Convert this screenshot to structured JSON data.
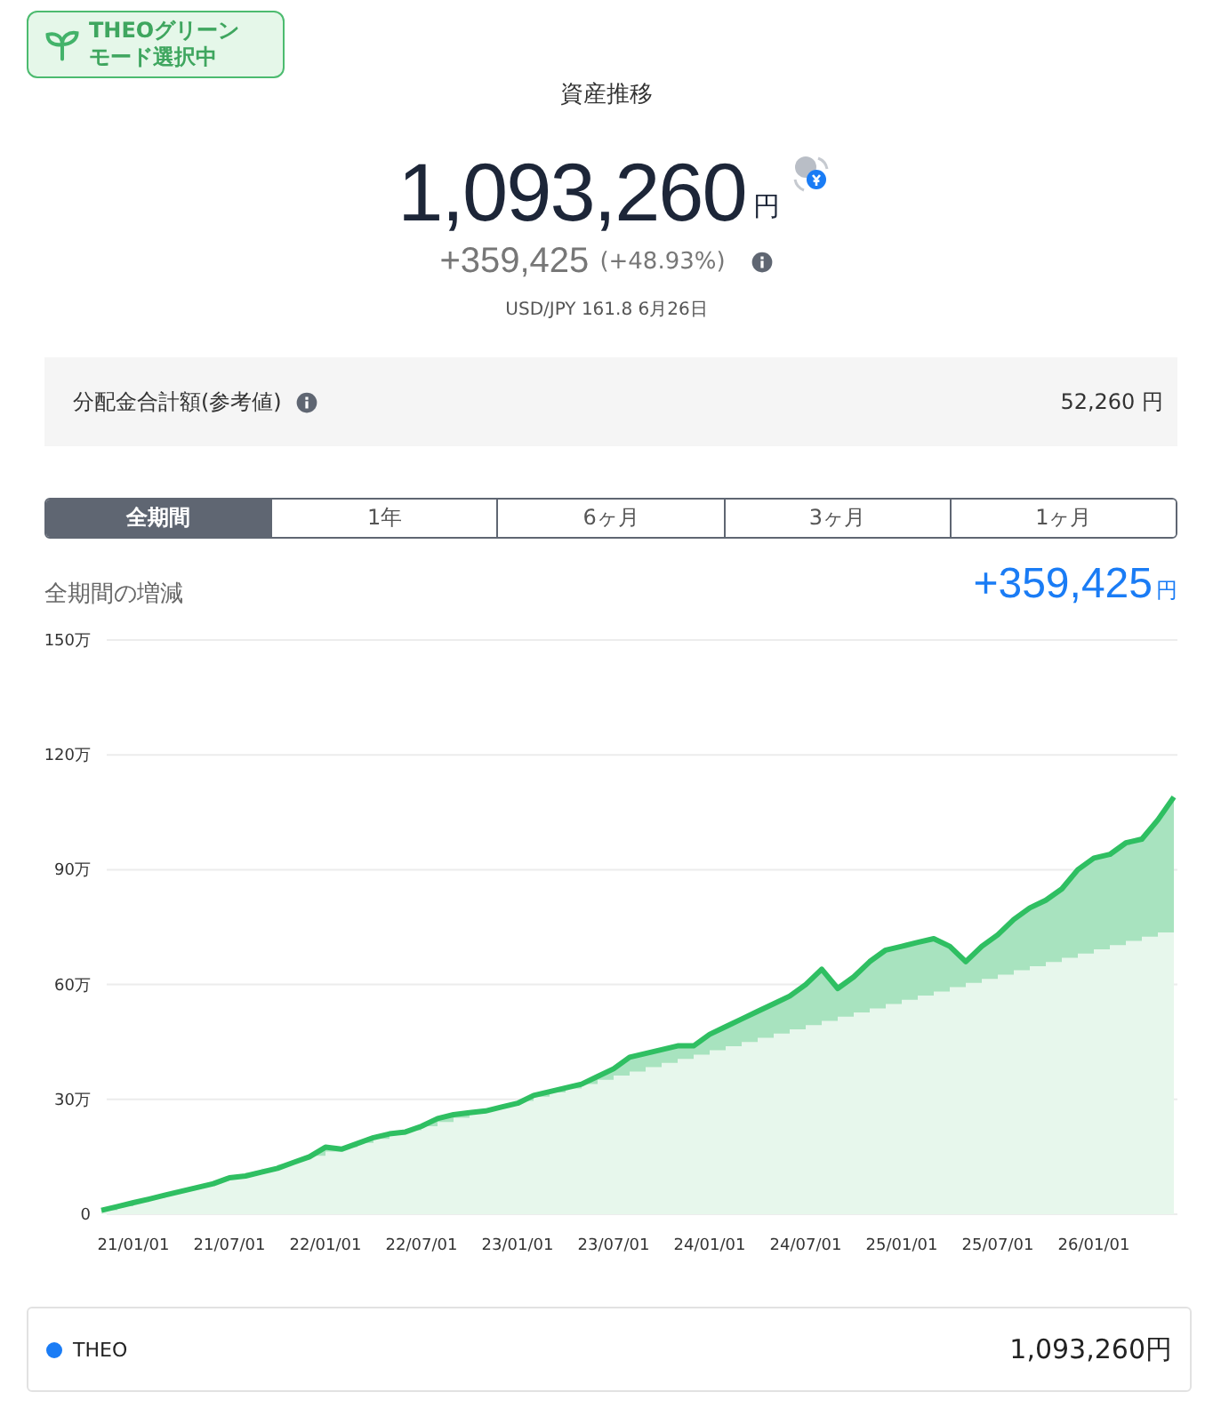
{
  "badge": {
    "line1": "THEOグリーン",
    "line2": "モード選択中"
  },
  "title": "資産推移",
  "total": {
    "amount": "1,093,260",
    "unit": "円",
    "change": "+359,425",
    "change_pct": "(+48.93%)",
    "rate": "USD/JPY 161.8 6月26日"
  },
  "dividend": {
    "label": "分配金合計額(参考値)",
    "value": "52,260 円"
  },
  "tabs": [
    {
      "label": "全期間",
      "selected": true
    },
    {
      "label": "1年",
      "selected": false
    },
    {
      "label": "6ヶ月",
      "selected": false
    },
    {
      "label": "3ヶ月",
      "selected": false
    },
    {
      "label": "1ヶ月",
      "selected": false
    }
  ],
  "period": {
    "label": "全期間の増減",
    "value": "+359,425",
    "unit": "円"
  },
  "chart": {
    "chart_data": {
      "type": "area",
      "grid": true,
      "ylim": [
        0,
        150
      ],
      "categories": [
        null,
        null,
        "21/01/01",
        null,
        null,
        null,
        null,
        null,
        "21/07/01",
        null,
        null,
        null,
        null,
        null,
        "22/01/01",
        null,
        null,
        null,
        null,
        null,
        "22/07/01",
        null,
        null,
        null,
        null,
        null,
        "23/01/01",
        null,
        null,
        null,
        null,
        null,
        "23/07/01",
        null,
        null,
        null,
        null,
        null,
        "24/01/01",
        null,
        null,
        null,
        null,
        null,
        "24/07/01",
        null,
        null,
        null,
        null,
        null,
        "25/01/01",
        null,
        null,
        null,
        null,
        null,
        "25/07/01",
        null,
        null,
        null,
        null,
        null,
        "26/01/01",
        null,
        null,
        null,
        null,
        null
      ],
      "yticks": [
        {
          "value": 0,
          "label": "0"
        },
        {
          "value": 30,
          "label": "30万"
        },
        {
          "value": 60,
          "label": "60万"
        },
        {
          "value": 90,
          "label": "90万"
        },
        {
          "value": 120,
          "label": "120万"
        },
        {
          "value": 150,
          "label": "150万"
        }
      ],
      "series": [
        {
          "color": "#2fbf62",
          "values": [
            1,
            2,
            3,
            4,
            5,
            6,
            7,
            8,
            9.5,
            10,
            11,
            12,
            13.5,
            15,
            17.5,
            17,
            18.5,
            20,
            21,
            21.5,
            23,
            25,
            26,
            26.5,
            27,
            28,
            29,
            31,
            32,
            33,
            34,
            36,
            38,
            41,
            42,
            43,
            44,
            44,
            47,
            49,
            51,
            53,
            55,
            57,
            60,
            64,
            59,
            62,
            66,
            69,
            70,
            71,
            72,
            70,
            66,
            70,
            73,
            77,
            80,
            82,
            85,
            90,
            93,
            94,
            97,
            98,
            103,
            109
          ]
        },
        {
          "color": "#e7f7ec",
          "values": [
            1,
            2.1,
            3.2,
            4.3,
            5.4,
            6.5,
            7.6,
            8.7,
            9.8,
            10.9,
            12,
            13.1,
            14.2,
            15.3,
            16.4,
            17.5,
            18.6,
            19.7,
            20.8,
            21.9,
            23,
            24.1,
            25.2,
            26.3,
            27.4,
            28.5,
            29.6,
            30.7,
            31.8,
            32.9,
            34,
            35.1,
            36.2,
            37.3,
            38.4,
            39.5,
            40.6,
            41.7,
            42.8,
            43.9,
            45,
            46.1,
            47.2,
            48.3,
            49.4,
            50.5,
            51.6,
            52.7,
            53.8,
            54.9,
            56,
            57.1,
            58.2,
            59.3,
            60.4,
            61.5,
            62.6,
            63.7,
            64.8,
            65.9,
            67,
            68.1,
            69.2,
            70.3,
            71.4,
            72.5,
            73.6,
            74.7
          ]
        }
      ]
    }
  },
  "legend": {
    "name": "THEO",
    "color": "#1a7cf5",
    "value": "1,093,260円"
  }
}
